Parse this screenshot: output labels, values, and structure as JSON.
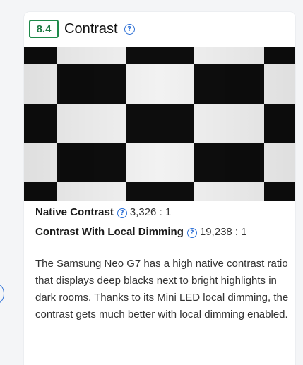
{
  "section": {
    "score": "8.4",
    "title": "Contrast",
    "help_icon": "question-circle-icon"
  },
  "metrics": [
    {
      "label": "Native Contrast",
      "value": "3,326 : 1",
      "help_icon": "question-circle-icon"
    },
    {
      "label": "Contrast With Local Dimming",
      "value": "19,238 : 1",
      "help_icon": "question-circle-icon"
    }
  ],
  "description": "The Samsung Neo G7 has a high native contrast ratio that displays deep blacks next to bright highlights in dark rooms. Thanks to its Mini LED local dimming, the contrast gets much better with local dimming enabled.",
  "test_image": {
    "pattern": "checkerboard",
    "colors": {
      "light": "#f2f2f2",
      "dark": "#0d0d0d"
    }
  },
  "colors": {
    "score_border": "#1e8a4a",
    "accent_blue": "#2b6fd6"
  }
}
